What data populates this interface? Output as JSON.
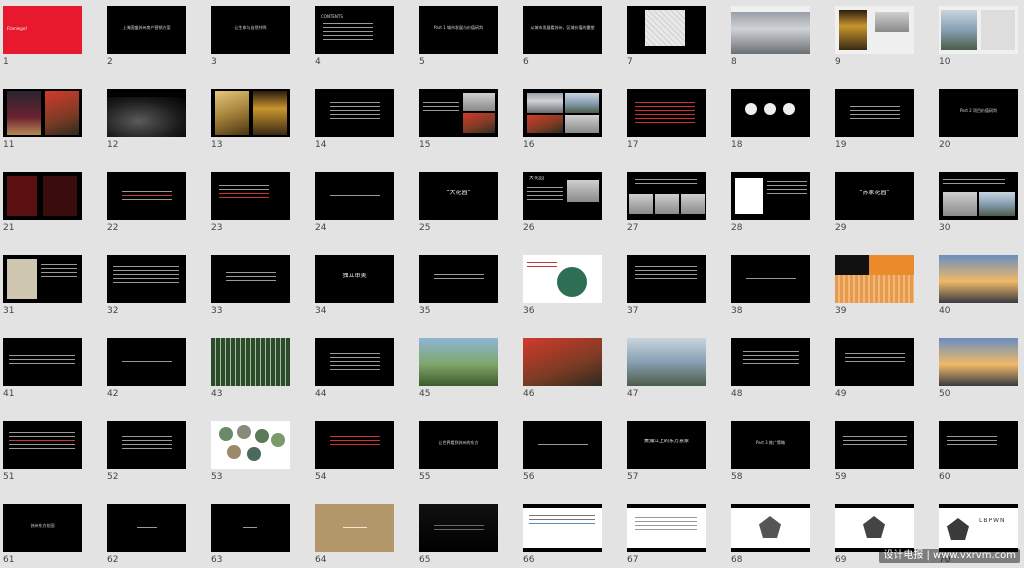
{
  "slides": [
    {
      "n": "1",
      "t": "Flamingo!"
    },
    {
      "n": "2",
      "t": "上海国盛苏州房产营销方案"
    },
    {
      "n": "3",
      "t": "让生命与自然共鸣"
    },
    {
      "n": "4",
      "t": "CONTENTS"
    },
    {
      "n": "5",
      "t": "Part 1  城市发展与价值研判"
    },
    {
      "n": "6",
      "t": "从城市发展看苏州，区域价值的重塑"
    },
    {
      "n": "7",
      "t": ""
    },
    {
      "n": "8",
      "t": ""
    },
    {
      "n": "9",
      "t": ""
    },
    {
      "n": "10",
      "t": ""
    },
    {
      "n": "11",
      "t": ""
    },
    {
      "n": "12",
      "t": ""
    },
    {
      "n": "13",
      "t": ""
    },
    {
      "n": "14",
      "t": ""
    },
    {
      "n": "15",
      "t": ""
    },
    {
      "n": "16",
      "t": ""
    },
    {
      "n": "17",
      "t": ""
    },
    {
      "n": "18",
      "t": ""
    },
    {
      "n": "19",
      "t": ""
    },
    {
      "n": "20",
      "t": "Part 2  项目价值研判"
    },
    {
      "n": "21",
      "t": ""
    },
    {
      "n": "22",
      "t": ""
    },
    {
      "n": "23",
      "t": ""
    },
    {
      "n": "24",
      "t": ""
    },
    {
      "n": "25",
      "t": "“大花园”"
    },
    {
      "n": "26",
      "t": "大花园"
    },
    {
      "n": "27",
      "t": ""
    },
    {
      "n": "28",
      "t": ""
    },
    {
      "n": "29",
      "t": "“苏家花园”"
    },
    {
      "n": "30",
      "t": ""
    },
    {
      "n": "31",
      "t": ""
    },
    {
      "n": "32",
      "t": ""
    },
    {
      "n": "33",
      "t": ""
    },
    {
      "n": "34",
      "t": "独立审美"
    },
    {
      "n": "35",
      "t": ""
    },
    {
      "n": "36",
      "t": ""
    },
    {
      "n": "37",
      "t": ""
    },
    {
      "n": "38",
      "t": ""
    },
    {
      "n": "39",
      "t": ""
    },
    {
      "n": "40",
      "t": ""
    },
    {
      "n": "41",
      "t": ""
    },
    {
      "n": "42",
      "t": ""
    },
    {
      "n": "43",
      "t": ""
    },
    {
      "n": "44",
      "t": ""
    },
    {
      "n": "45",
      "t": ""
    },
    {
      "n": "46",
      "t": ""
    },
    {
      "n": "47",
      "t": ""
    },
    {
      "n": "48",
      "t": ""
    },
    {
      "n": "49",
      "t": ""
    },
    {
      "n": "50",
      "t": ""
    },
    {
      "n": "51",
      "t": ""
    },
    {
      "n": "52",
      "t": ""
    },
    {
      "n": "53",
      "t": ""
    },
    {
      "n": "54",
      "t": ""
    },
    {
      "n": "55",
      "t": "让世界看到苏州的东方"
    },
    {
      "n": "56",
      "t": ""
    },
    {
      "n": "57",
      "t": "黄浦江上的东方意象"
    },
    {
      "n": "58",
      "t": "Part 3  推广策略"
    },
    {
      "n": "59",
      "t": ""
    },
    {
      "n": "60",
      "t": ""
    },
    {
      "n": "61",
      "t": "苏州东方花园"
    },
    {
      "n": "62",
      "t": ""
    },
    {
      "n": "63",
      "t": ""
    },
    {
      "n": "64",
      "t": ""
    },
    {
      "n": "65",
      "t": ""
    },
    {
      "n": "66",
      "t": ""
    },
    {
      "n": "67",
      "t": ""
    },
    {
      "n": "68",
      "t": ""
    },
    {
      "n": "69",
      "t": ""
    },
    {
      "n": "70",
      "t": "LBPWN"
    }
  ],
  "watermark": "设计电报 | www.vxrvm.com"
}
